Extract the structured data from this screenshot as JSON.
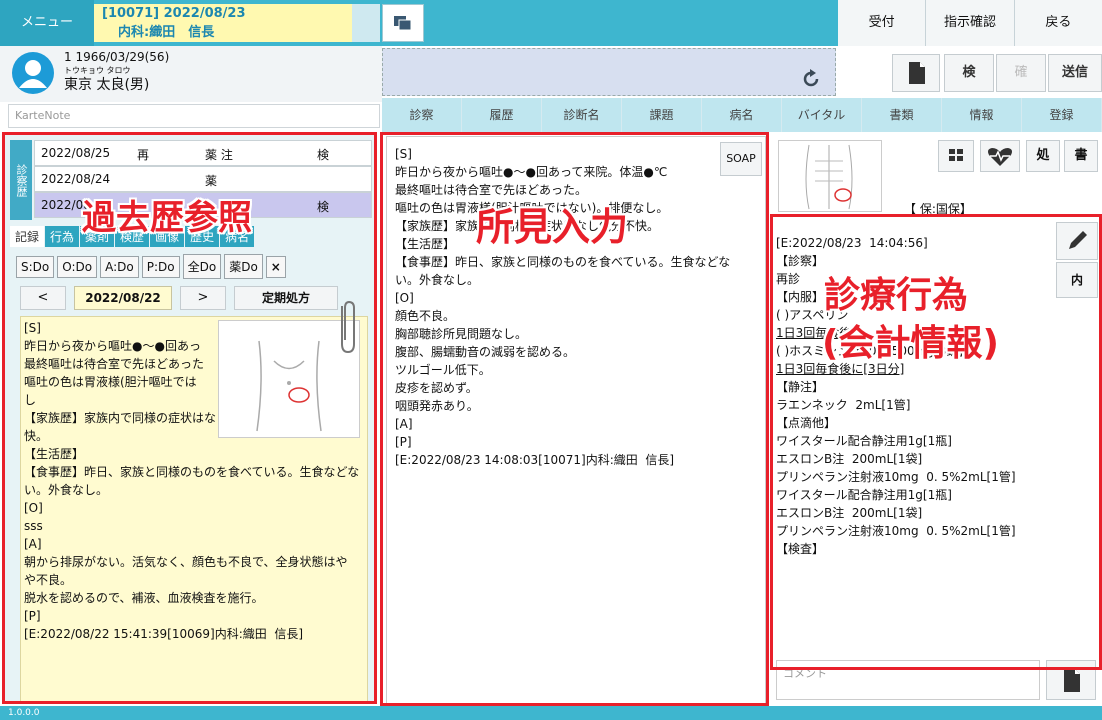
{
  "header": {
    "menu_label": "メニュー",
    "encounter_line1": "[10071] 2022/08/23",
    "encounter_line2": "内科:織田　信長",
    "buttons": [
      "受付",
      "指示確認",
      "戻る"
    ]
  },
  "patient": {
    "line1": "1  1966/03/29(56)",
    "kana": "トウキョウ  タロウ",
    "name": "東京  太良(男)"
  },
  "karte_note": {
    "placeholder": "KarteNote"
  },
  "toolbar": {
    "check_label": "検",
    "confirm_label": "確",
    "send_label": "送信"
  },
  "nav_tabs": [
    "診察",
    "履歴",
    "診断名",
    "課題",
    "病名",
    "バイタル",
    "書類",
    "情報",
    "登録"
  ],
  "history": {
    "side_label": "診察歴",
    "rows": [
      {
        "date": "2022/08/25",
        "type": "再",
        "items": "薬 注",
        "ex": "検"
      },
      {
        "date": "2022/08/24",
        "type": "",
        "items": "薬",
        "ex": ""
      },
      {
        "date": "2022/08",
        "type": "",
        "items": "",
        "ex": "検"
      }
    ],
    "tabs": [
      "記録",
      "行為",
      "薬剤",
      "検歴",
      "画像",
      "歴史",
      "病名"
    ],
    "do_buttons": [
      "S:Do",
      "O:Do",
      "A:Do",
      "P:Do",
      "全Do",
      "薬Do"
    ],
    "close": "×",
    "prev": "<",
    "next": ">",
    "date": "2022/08/22",
    "teiki": "定期処方",
    "record_lines": [
      "[S]",
      "昨日から夜から嘔吐●～●回あっ",
      "最終嘔吐は待合室で先ほどあった",
      "嘔吐の色は胃液様(胆汁嘔吐では",
      "し",
      "【家族歴】家族内で同様の症状はな",
      "快。",
      "【生活歴】",
      "【食事歴】昨日、家族と同様のものを食べている。生食などな",
      "い。外食なし。",
      "",
      "[O]",
      "sss",
      "[A]",
      "朝から排尿がない。活気なく、顔色も不良で、全身状態はや",
      "や不良。",
      "脱水を認めるので、補液、血液検査を施行。",
      "",
      "[P]",
      "",
      "[E:2022/08/22 15:41:39[10069]内科:織田  信長]"
    ]
  },
  "findings": {
    "soap_label": "SOAP",
    "lines": [
      "[S]",
      "昨日から夜から嘔吐●～●回あって来院。体温●℃",
      "最終嘔吐は待合室で先ほどあった。",
      "嘔吐の色は胃液様(胆汁嘔吐ではない)。排便なし。",
      "【家族歴】家族内で同様の症状はなし気分不快。",
      "【生活歴】",
      "【食事歴】昨日、家族と同様のものを食べている。生食などな",
      "い。外食なし。",
      "",
      "[O]",
      "顔色不良。",
      "胸部聴診所見問題なし。",
      "腹部、腸蠕動音の減弱を認める。",
      "ツルゴール低下。",
      "皮疹を認めず。",
      "咽頭発赤あり。",
      "",
      "[A]",
      "",
      "[P]",
      "",
      "[E:2022/08/23 14:08:03[10071]内科:織田  信長]"
    ]
  },
  "right_icons": {
    "prescribe": "処",
    "write": "書"
  },
  "insurance": "【 保:国保】",
  "orders": {
    "inner_label": "内",
    "lines": [
      {
        "t": "[E:2022/08/23  14:04:56]",
        "u": false
      },
      {
        "t": "【診察】",
        "u": false
      },
      {
        "t": "再診",
        "u": false
      },
      {
        "t": "",
        "u": false
      },
      {
        "t": "【内服】",
        "u": false
      },
      {
        "t": "( )アスペリン",
        "u": false
      },
      {
        "t": "1日3回毎食後",
        "u": true
      },
      {
        "t": "",
        "u": false
      },
      {
        "t": "( )ホスミシン錠500  500mg[3錠]",
        "u": false
      },
      {
        "t": "1日3回毎食後に[3日分]",
        "u": true
      },
      {
        "t": "",
        "u": false
      },
      {
        "t": "【静注】",
        "u": false
      },
      {
        "t": "ラエンネック  2mL[1管]",
        "u": false
      },
      {
        "t": "",
        "u": false
      },
      {
        "t": "【点滴他】",
        "u": false
      },
      {
        "t": "ワイスタール配合静注用1g[1瓶]",
        "u": false
      },
      {
        "t": "エスロンB注  200mL[1袋]",
        "u": false
      },
      {
        "t": "プリンペラン注射液10mg  0. 5%2mL[1管]",
        "u": false
      },
      {
        "t": "",
        "u": false
      },
      {
        "t": "ワイスタール配合静注用1g[1瓶]",
        "u": false
      },
      {
        "t": "エスロンB注  200mL[1袋]",
        "u": false
      },
      {
        "t": "プリンペラン注射液10mg  0. 5%2mL[1管]",
        "u": false
      },
      {
        "t": "",
        "u": false
      },
      {
        "t": "【検査】",
        "u": false
      }
    ],
    "comment_placeholder": "コメント"
  },
  "annotations": {
    "past": "過去歴参照",
    "findings": "所見入力",
    "orders_line1": "診療行為",
    "orders_line2": "(会計情報)"
  },
  "footer": {
    "version": "1.0.0.0"
  },
  "colors": {
    "teal": "#3eb6cf",
    "accent_red": "#e8202a",
    "highlight_yellow": "#fffbd0"
  }
}
